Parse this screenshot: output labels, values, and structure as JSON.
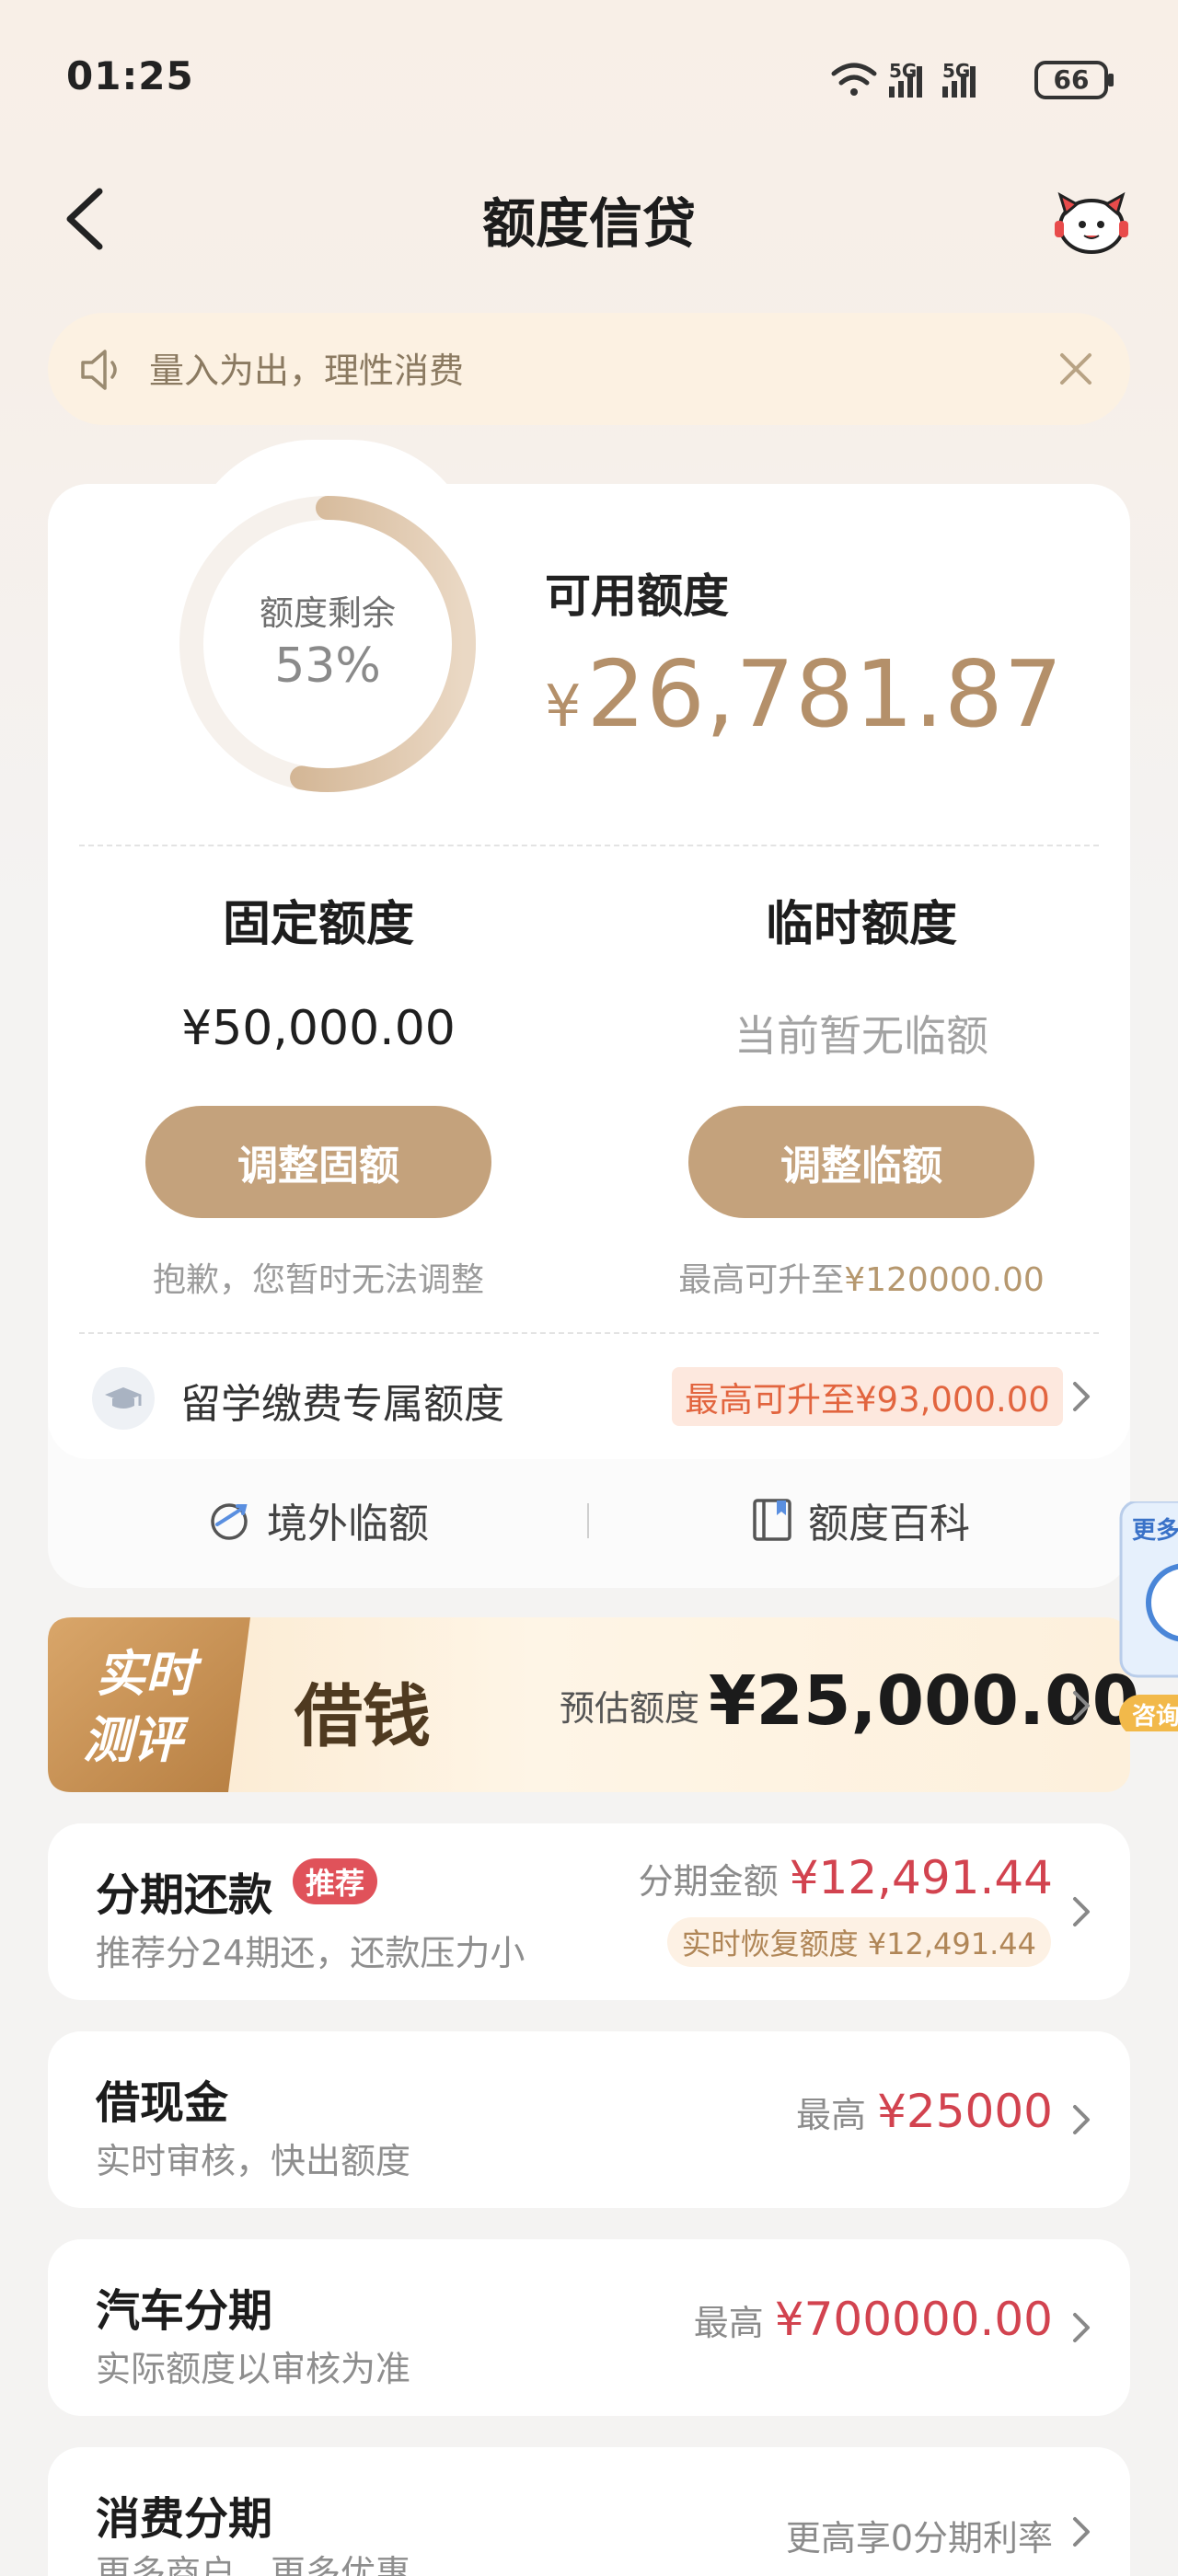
{
  "status_bar": {
    "time": "01:25",
    "battery": "66",
    "network_1": "5G",
    "network_2": "5G"
  },
  "header": {
    "title": "额度信贷"
  },
  "notice": {
    "text": "量入为出，理性消费"
  },
  "credit": {
    "ring_label": "额度剩余",
    "ring_percent": "53%",
    "remaining_fraction": 0.53,
    "available_label": "可用额度",
    "available_currency": "¥",
    "available_amount": "26,781.87",
    "fixed": {
      "title": "固定额度",
      "value": "¥50,000.00",
      "button": "调整固额",
      "note": "抱歉，您暂时无法调整"
    },
    "temp": {
      "title": "临时额度",
      "value": "当前暂无临额",
      "button": "调整临额",
      "note_prefix": "最高可升至",
      "note_amount": "¥120000.00"
    },
    "study": {
      "label": "留学缴费专属额度",
      "badge": "最高可升至¥93,000.00"
    },
    "links": {
      "overseas": "境外临额",
      "wiki": "额度百科"
    }
  },
  "borrow_banner": {
    "tag_line1": "实时",
    "tag_line2": "测评",
    "title": "借钱",
    "estimate_label": "预估额度",
    "estimate_amount": "¥25,000.00"
  },
  "floating_widget": {
    "top_text": "更多",
    "bottom_text": "咨询"
  },
  "products": [
    {
      "title": "分期还款",
      "tag": "推荐",
      "subtitle": "推荐分24期还，还款压力小",
      "right_label": "分期金额",
      "right_value": "¥12,491.44",
      "chip": "实时恢复额度 ¥12,491.44"
    },
    {
      "title": "借现金",
      "subtitle": "实时审核，快出额度",
      "right_label": "最高",
      "right_value": "¥25000"
    },
    {
      "title": "汽车分期",
      "subtitle": "实际额度以审核为准",
      "right_label": "最高",
      "right_value": "¥700000.00"
    },
    {
      "title": "消费分期",
      "subtitle": "更多商户，更多优惠",
      "right_label": "更高享0分期利率"
    }
  ],
  "colors": {
    "accent": "#c4a27c",
    "amount": "#b4906a",
    "red": "#d2434f",
    "badge": "#e2653f"
  }
}
